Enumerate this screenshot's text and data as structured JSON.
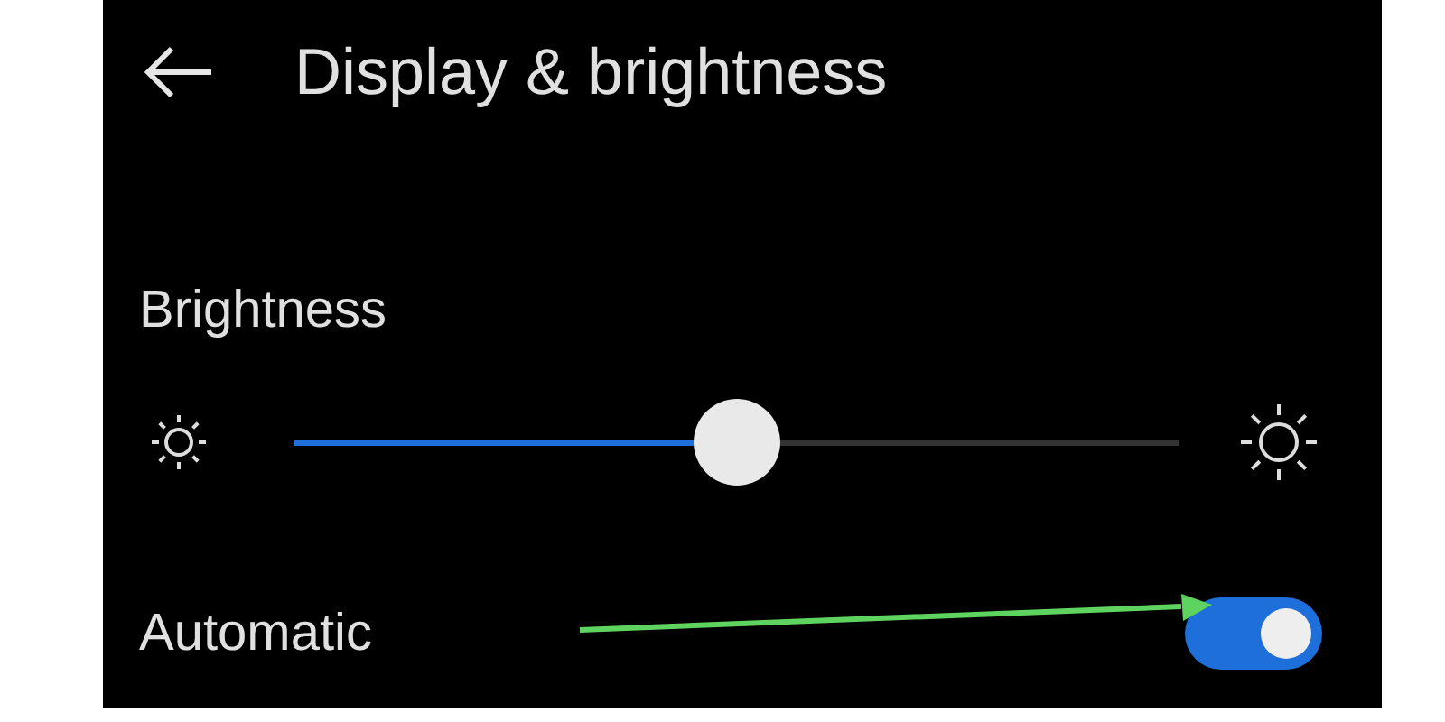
{
  "header": {
    "title": "Display & brightness"
  },
  "brightness": {
    "label": "Brightness",
    "level": 0.5
  },
  "automatic": {
    "label": "Automatic",
    "on": true
  }
}
